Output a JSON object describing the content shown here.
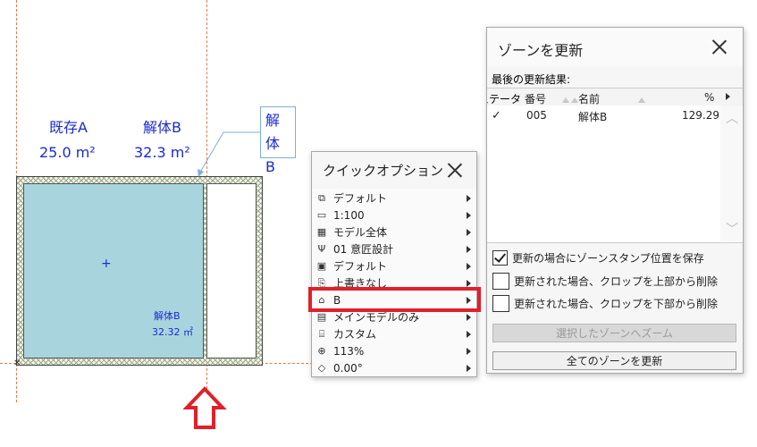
{
  "canvas": {
    "zone_a_name": "既存A",
    "zone_a_area": "25.0 m²",
    "zone_b_name": "解体B",
    "zone_b_area": "32.3 m²",
    "stamp_line1": "解体",
    "stamp_line2": "B",
    "room_label_name": "解体B",
    "room_label_area": "32.32 ㎡",
    "guide_color": "#e07a4a",
    "zone_fill_color": "#a8d4de",
    "label_color": "#1a2bd0"
  },
  "quick_options": {
    "title": "クイックオプション",
    "items": [
      {
        "icon": "layer-icon",
        "label": "デフォルト"
      },
      {
        "icon": "scale-icon",
        "label": "1:100"
      },
      {
        "icon": "model-view-icon",
        "label": "モデル全体"
      },
      {
        "icon": "pen-icon",
        "label": "01 意匠設計"
      },
      {
        "icon": "dimension-icon",
        "label": "デフォルト"
      },
      {
        "icon": "override-icon",
        "label": "上書きなし"
      },
      {
        "icon": "renovation-icon",
        "label": "B"
      },
      {
        "icon": "structure-icon",
        "label": "メインモデルのみ"
      },
      {
        "icon": "custom-icon",
        "label": "カスタム"
      },
      {
        "icon": "zoom-icon",
        "label": "113%"
      },
      {
        "icon": "angle-icon",
        "label": "0.00°"
      }
    ],
    "highlighted_index": 6,
    "highlight_color": "#e0202a"
  },
  "update_zones": {
    "title": "ゾーンを更新",
    "last_results_label": "最後の更新結果:",
    "columns": {
      "status": "ステータス",
      "number": "番号",
      "name": "名前",
      "percent": "%"
    },
    "rows": [
      {
        "status": "✓",
        "number": "005",
        "name": "解体B",
        "percent": "129.29"
      }
    ],
    "checkboxes": [
      {
        "label": "更新の場合にゾーンスタンプ位置を保存",
        "checked": true
      },
      {
        "label": "更新された場合、クロップを上部から削除",
        "checked": false
      },
      {
        "label": "更新された場合、クロップを下部から削除",
        "checked": false
      }
    ],
    "zoom_button": "選択したゾーンへズーム",
    "update_all_button": "全てのゾーンを更新"
  }
}
